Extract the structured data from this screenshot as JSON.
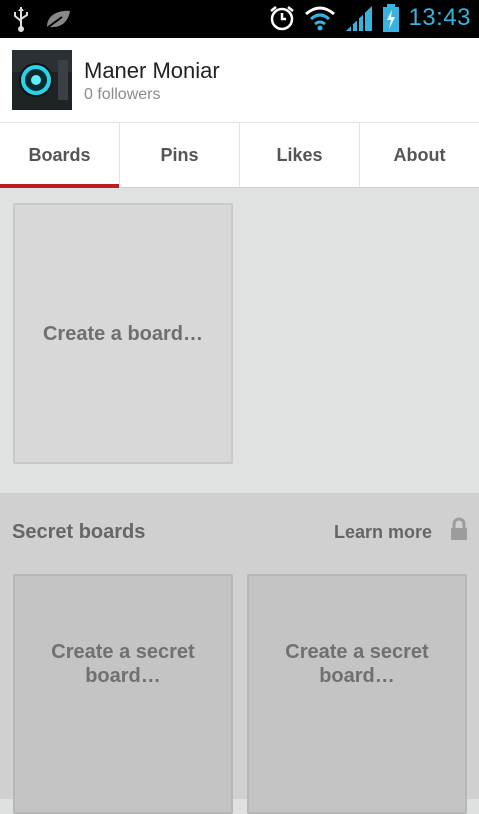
{
  "status_bar": {
    "time": "13:43",
    "icons": [
      "usb-icon",
      "leaf-icon",
      "alarm-icon",
      "wifi-icon",
      "signal-icon",
      "battery-charging-icon"
    ],
    "accent_color": "#36b3e0"
  },
  "profile": {
    "name": "Maner Moniar",
    "followers": "0 followers"
  },
  "tabs": [
    {
      "label": "Boards",
      "active": true
    },
    {
      "label": "Pins",
      "active": false
    },
    {
      "label": "Likes",
      "active": false
    },
    {
      "label": "About",
      "active": false
    }
  ],
  "boards": {
    "create_label": "Create a board…"
  },
  "secret": {
    "title": "Secret boards",
    "learn_more": "Learn more",
    "cards": [
      {
        "label": "Create a secret board…"
      },
      {
        "label": "Create a secret board…"
      }
    ]
  },
  "colors": {
    "active_tab_indicator": "#b81e22"
  }
}
